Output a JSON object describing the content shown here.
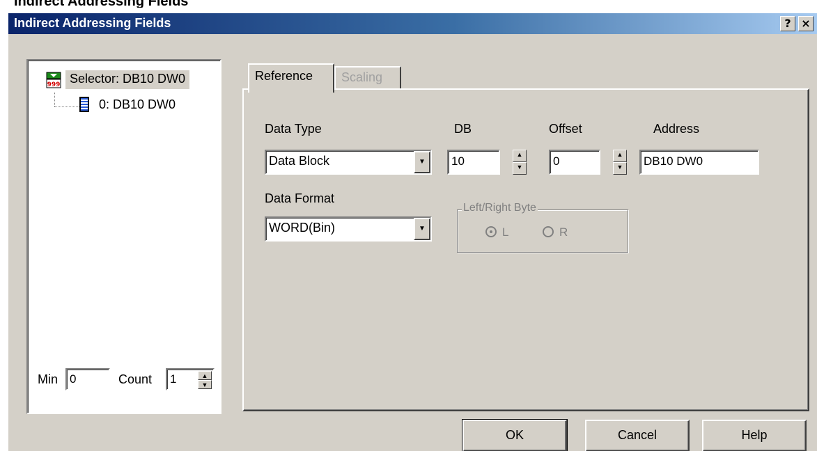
{
  "page": {
    "heading": "Indirect Addressing Fields"
  },
  "window": {
    "title": "Indirect Addressing Fields",
    "help_button": "?",
    "close_button": "×"
  },
  "tree": {
    "items": [
      {
        "label": "Selector: DB10 DW0",
        "icon": "selector-999-icon"
      },
      {
        "label": "0:  DB10 DW0",
        "icon": "list-icon"
      }
    ],
    "selector_icon_text": "999"
  },
  "range": {
    "min_label": "Min",
    "min_value": "0",
    "count_label": "Count",
    "count_value": "1"
  },
  "tabs": [
    {
      "label": "Reference",
      "active": true
    },
    {
      "label": "Scaling",
      "active": false
    }
  ],
  "reference": {
    "data_type_label": "Data Type",
    "data_type_value": "Data Block",
    "db_label": "DB",
    "db_value": "10",
    "offset_label": "Offset",
    "offset_value": "0",
    "address_label": "Address",
    "address_value": "DB10 DW0",
    "data_format_label": "Data Format",
    "data_format_value": "WORD(Bin)",
    "byte_group_label": "Left/Right Byte",
    "byte_options": [
      {
        "label": "L",
        "selected": true
      },
      {
        "label": "R",
        "selected": false
      }
    ]
  },
  "buttons": {
    "ok": "OK",
    "cancel": "Cancel",
    "help": "Help"
  },
  "colors": {
    "dialog_face": "#d4d0c8",
    "title_start": "#0a246a",
    "title_end": "#a6caf0"
  }
}
